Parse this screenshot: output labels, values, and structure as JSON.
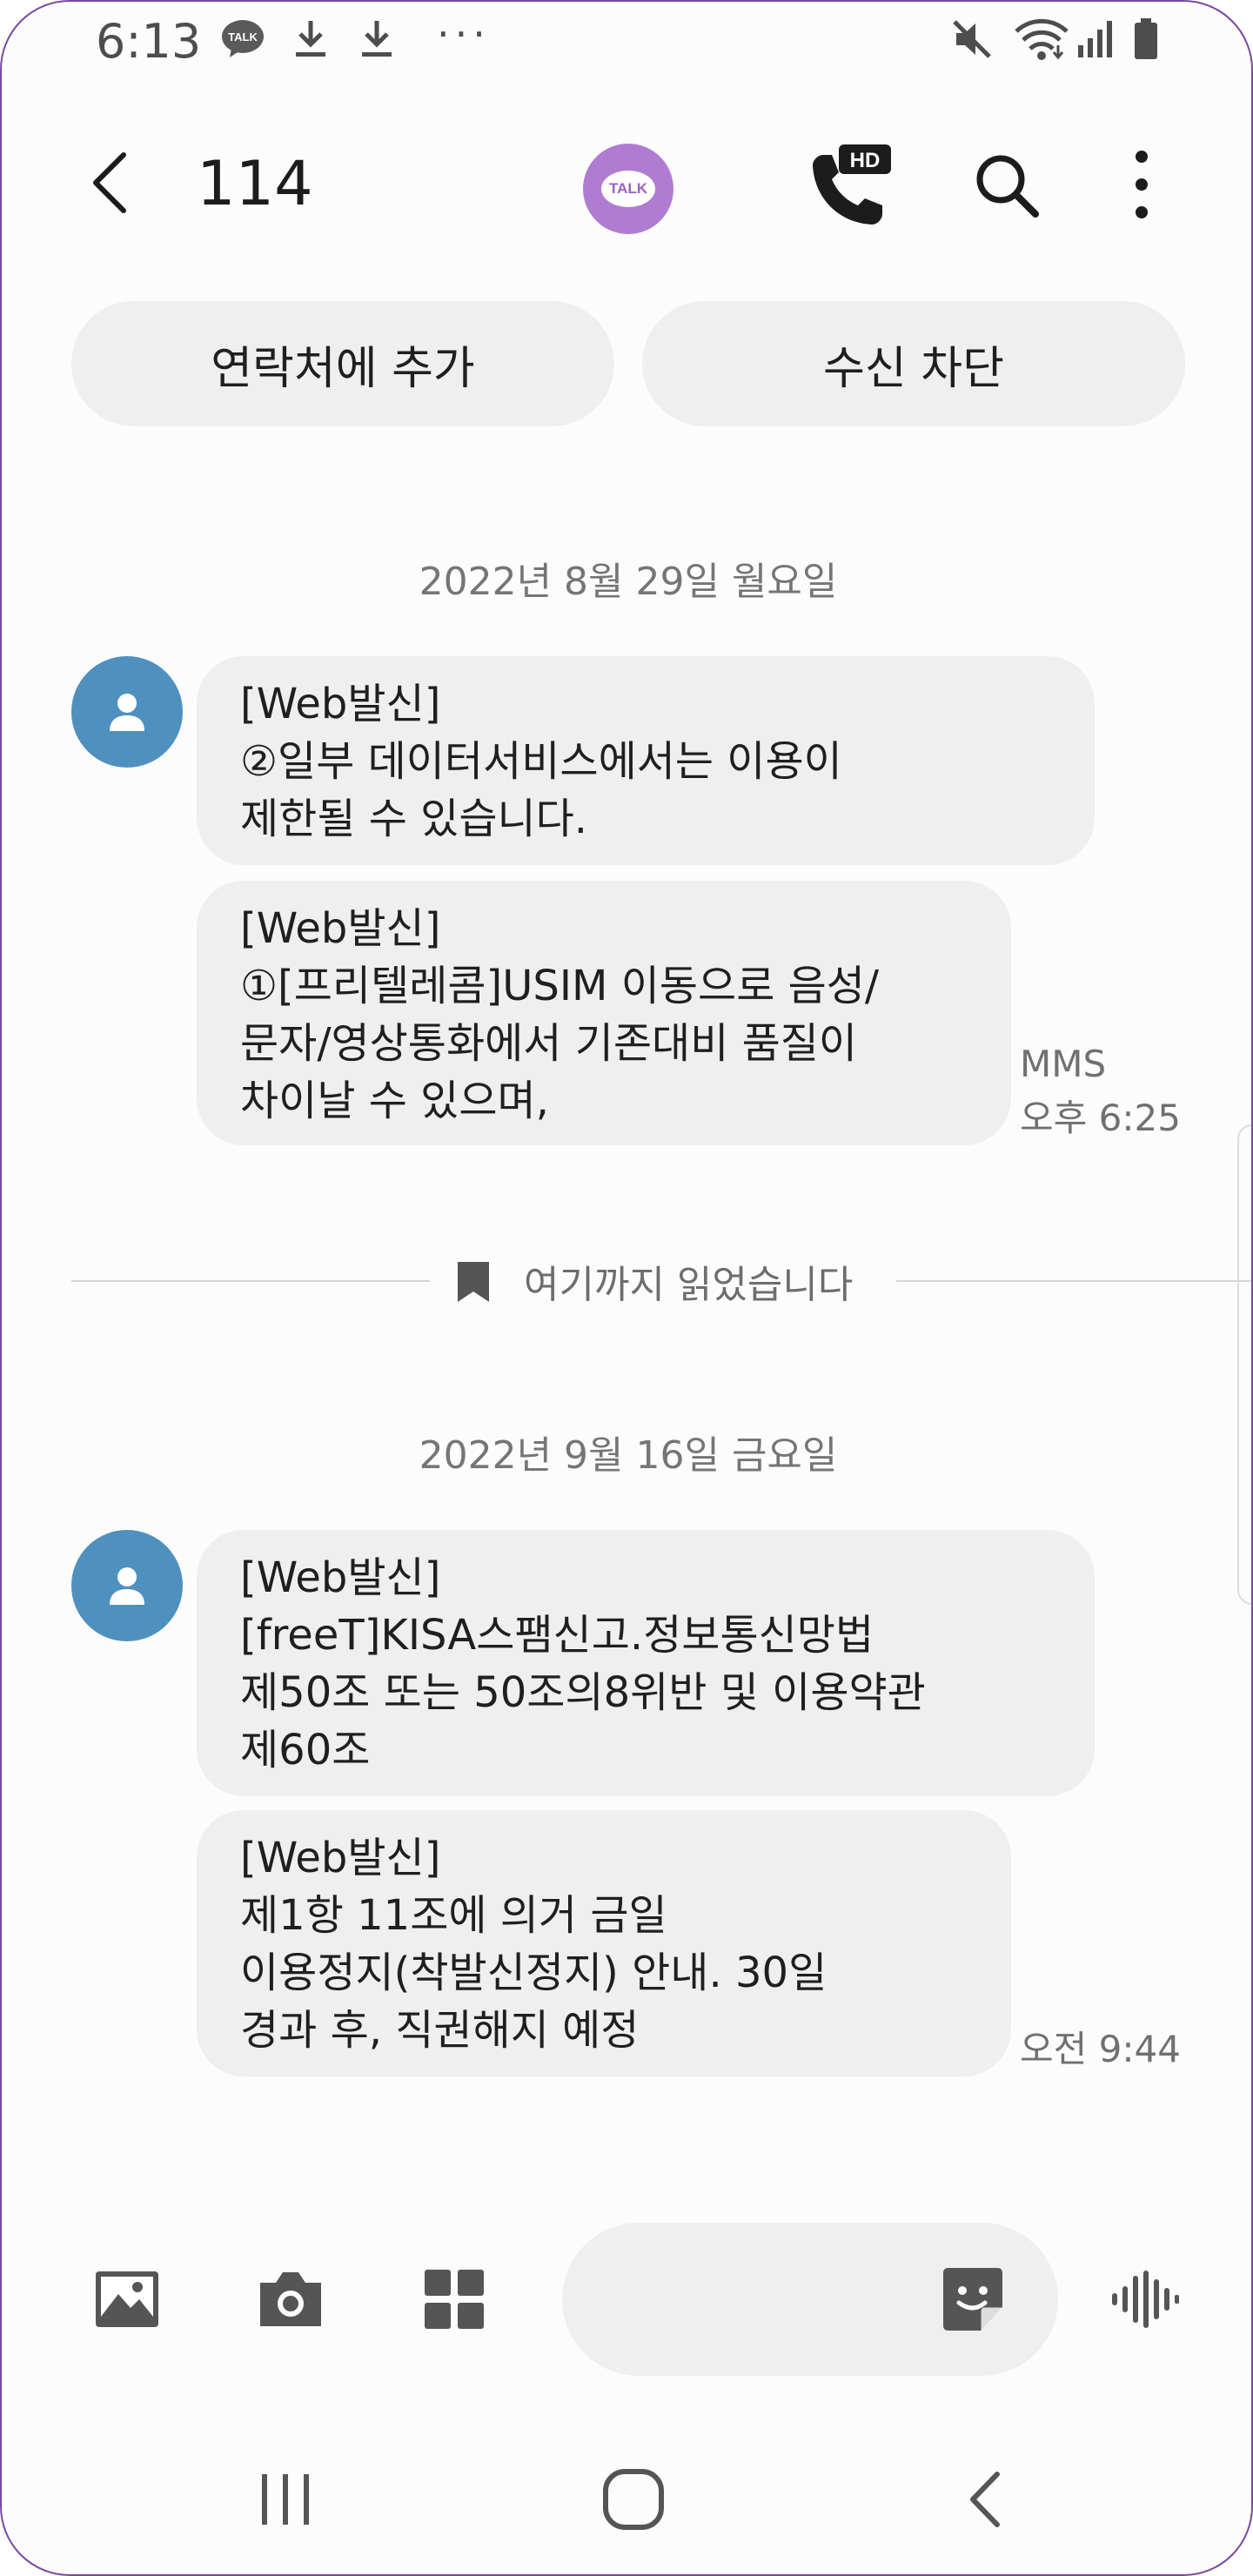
{
  "status_bar": {
    "time": "6:13",
    "talk_notification": "TALK",
    "overflow": "···",
    "icons": [
      "talk-notification-icon",
      "download-icon",
      "download-icon",
      "mute-icon",
      "wifi-icon",
      "signal-icon",
      "battery-icon"
    ]
  },
  "app_bar": {
    "title": "114",
    "talk_label": "TALK",
    "hd_label": "HD",
    "icons": [
      "back-arrow-icon",
      "kakaotalk-icon",
      "hd-call-icon",
      "search-icon",
      "more-vert-icon"
    ]
  },
  "actions": {
    "add_contact": "연락처에 추가",
    "block": "수신 차단"
  },
  "conversation": {
    "groups": [
      {
        "date": "2022년 8월 29일 월요일",
        "messages": [
          {
            "lines": [
              "[Web발신]",
              "②일부 데이터서비스에서는 이용이",
              "제한될 수 있습니다."
            ]
          },
          {
            "lines": [
              "[Web발신]",
              "①[프리텔레콤]USIM 이동으로 음성/",
              "문자/영상통화에서 기존대비 품질이",
              "차이날 수 있으며,"
            ],
            "type": "MMS",
            "time": "오후 6:25"
          }
        ]
      },
      {
        "date": "2022년 9월 16일 금요일",
        "messages": [
          {
            "lines": [
              "[Web발신]",
              "[freeT]KISA스팸신고.정보통신망법",
              "제50조 또는 50조의8위반 및 이용약관",
              "제60조"
            ]
          },
          {
            "lines": [
              "[Web발신]",
              "제1항 11조에 의거 금일",
              "이용정지(착발신정지) 안내. 30일",
              "경과 후, 직권해지 예정"
            ],
            "time": "오전 9:44"
          }
        ]
      }
    ],
    "read_marker": "여기까지 읽었습니다"
  },
  "compose": {
    "placeholder": "",
    "icons": [
      "gallery-icon",
      "camera-icon",
      "apps-grid-icon",
      "sticker-icon",
      "voice-record-icon"
    ]
  },
  "nav_bar": {
    "icons": [
      "recent-apps-icon",
      "home-icon",
      "back-icon"
    ]
  },
  "colors": {
    "frame_border": "#7a4a9c",
    "talk_badge": "#b07cd1",
    "avatar": "#4f90bf",
    "bubble": "#efefef",
    "icon_gray": "#4d4d4d"
  }
}
